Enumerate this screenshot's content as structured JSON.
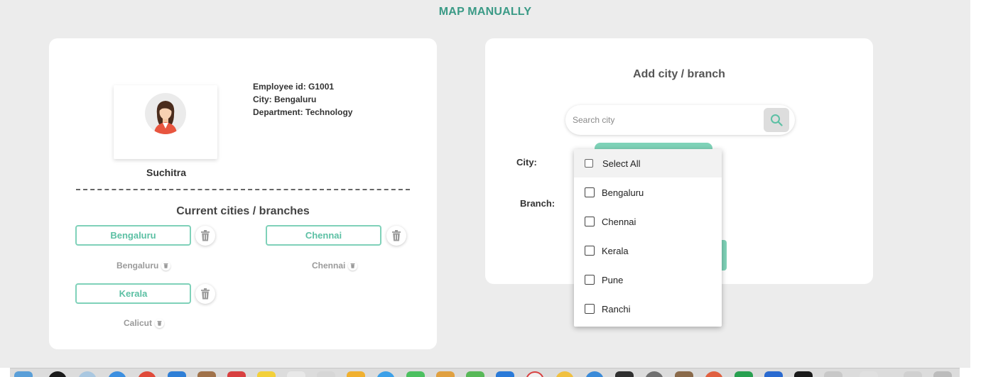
{
  "page": {
    "title": "MAP MANUALLY"
  },
  "employee": {
    "id_line": "Employee id: G1001",
    "city_line": "City: Bengaluru",
    "department_line": "Department: Technology",
    "name": "Suchitra"
  },
  "current": {
    "title": "Current cities / branches",
    "items": [
      {
        "chip": "Bengaluru",
        "sub": "Bengaluru"
      },
      {
        "chip": "Chennai",
        "sub": "Chennai"
      },
      {
        "chip": "Kerala",
        "sub": "Calicut"
      }
    ]
  },
  "add": {
    "title": "Add city / branch",
    "search_placeholder": "Search city",
    "city_label": "City:",
    "branch_label": "Branch:"
  },
  "dropdown": {
    "select_all": "Select All",
    "options": [
      "Bengaluru",
      "Chennai",
      "Kerala",
      "Pune",
      "Ranchi"
    ]
  },
  "colors": {
    "accent": "#3a9a86",
    "chip_border": "#7fd1b9",
    "chip_text": "#5cc0a4",
    "background": "#ececec"
  },
  "icons": {
    "search": "search-icon",
    "trash": "trash-icon",
    "avatar": "user-avatar-icon"
  }
}
